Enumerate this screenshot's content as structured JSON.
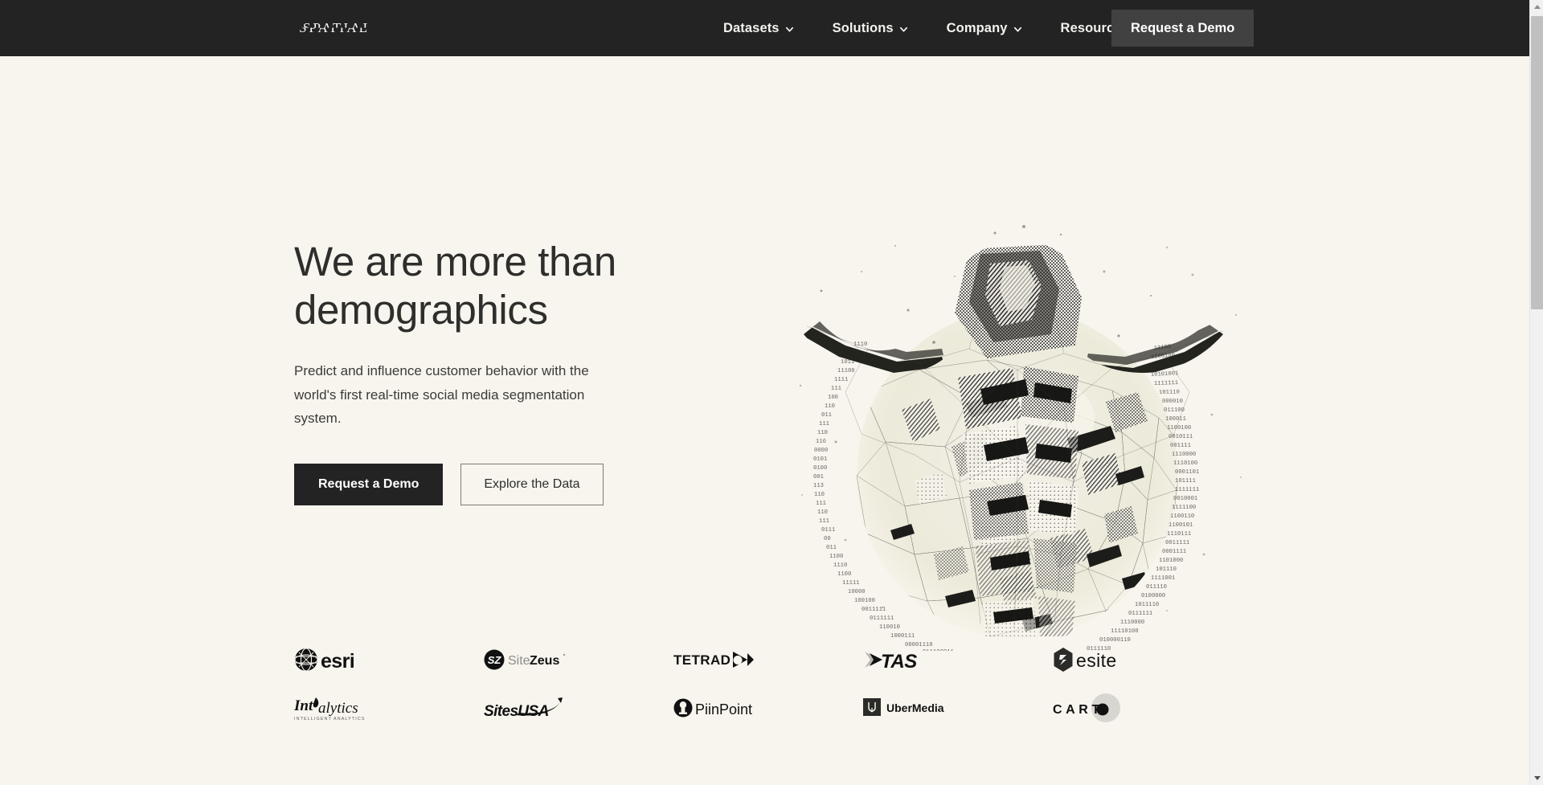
{
  "meta": {
    "background_color": "#f8f5ee",
    "nav_background_color": "#232323",
    "accent_dark": "#232323",
    "text_color": "#2e2e2c"
  },
  "navbar": {
    "brand": "SPATIAL",
    "links": [
      {
        "label": "Datasets",
        "icon": "chevron-down-icon"
      },
      {
        "label": "Solutions",
        "icon": "chevron-down-icon"
      },
      {
        "label": "Company",
        "icon": "chevron-down-icon"
      },
      {
        "label": "Resources",
        "icon": "chevron-down-icon"
      }
    ],
    "cta_label": "Request a Demo"
  },
  "hero": {
    "title_line1": "We are more than",
    "title_line2": "demographics",
    "subtitle": "Predict and influence customer behavior with the world's first real-time social media segmentation system.",
    "primary_button": "Request a Demo",
    "secondary_button": "Explore the Data",
    "artwork_alt": "Abstract halftone illustration of a person with arms outstretched, composed of polygonal mesh lines and binary digits forming a sphere"
  },
  "partners": {
    "logos": [
      {
        "name": "esri",
        "label": "esri",
        "icon": "globe-icon"
      },
      {
        "name": "sitezeus",
        "label": "SiteZeus",
        "label_bold": "Zeus",
        "label_light": "Site",
        "icon": "sz-badge-icon"
      },
      {
        "name": "tetrad",
        "label": "TETRAD",
        "icon": "play-triangle-icon"
      },
      {
        "name": "tas",
        "label": "TAS",
        "icon": "arrow-chevron-icon"
      },
      {
        "name": "esite",
        "label": "esite",
        "icon": "hexagon-icon"
      },
      {
        "name": "intalytics",
        "label": "Intalytics",
        "tagline": "INTELLIGENT ANALYTICS",
        "icon": "flame-icon"
      },
      {
        "name": "sitesusa",
        "label": "SitesUSA",
        "icon": "swoosh-icon"
      },
      {
        "name": "piinpoint",
        "label": "PiinPoint",
        "icon": "pin-circle-icon"
      },
      {
        "name": "ubermedia",
        "label": "UberMedia",
        "icon": "uber-square-icon"
      },
      {
        "name": "carto",
        "label": "CARTO",
        "icon": "dot-circle-icon"
      }
    ]
  },
  "scrollbar": {
    "up_arrow": "scroll-up-icon",
    "down_arrow": "scroll-down-icon",
    "thumb": "scroll-thumb"
  }
}
